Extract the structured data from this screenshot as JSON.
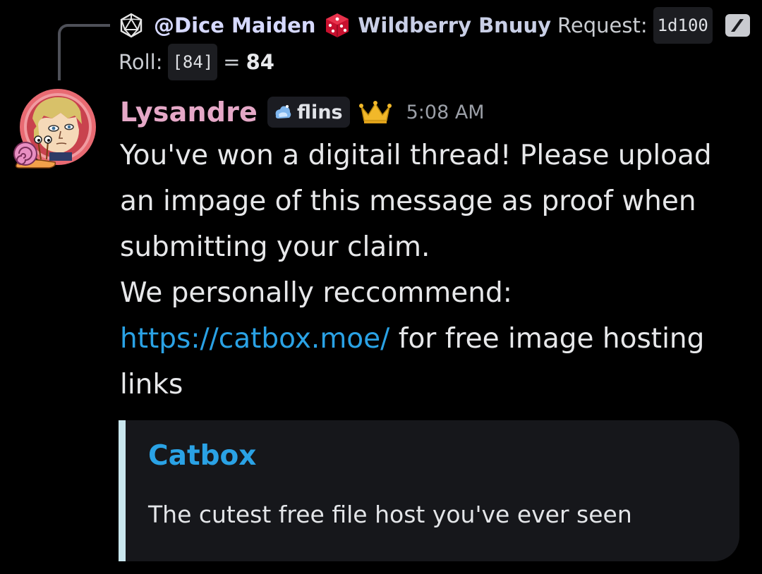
{
  "reply": {
    "bot_icon": "dice-d20-icon",
    "mention": "@Dice Maiden",
    "die_icon": "red-die-icon",
    "author": "Wildberry Bnuuy",
    "request_label": "Request:",
    "request_code": "1d100",
    "slash_icon": "slash-command-icon",
    "roll_label": "Roll:",
    "roll_code": "[84]",
    "roll_equals": "=",
    "roll_total": "84"
  },
  "message": {
    "avatar": "user-avatar",
    "avatar_decoration": "snail-decoration-icon",
    "username": "Lysandre",
    "tag_icon": "flins-badge-icon",
    "tag": "flins",
    "crown_icon": "crown-icon",
    "timestamp": "5:08 AM",
    "lines": [
      "You've won a digitail thread! Please upload an impage of this message as proof when submitting your claim.",
      "We personally reccommend:"
    ],
    "link_text": "https://catbox.moe/",
    "after_link": " for free image hosting links"
  },
  "embed": {
    "title": "Catbox",
    "description": "The cutest free file host you've ever seen"
  },
  "colors": {
    "background": "#000000",
    "username": "#e5a8c7",
    "link": "#2aa2e5",
    "embed_bar": "#c9e6ee",
    "embed_bg": "#16171b"
  }
}
